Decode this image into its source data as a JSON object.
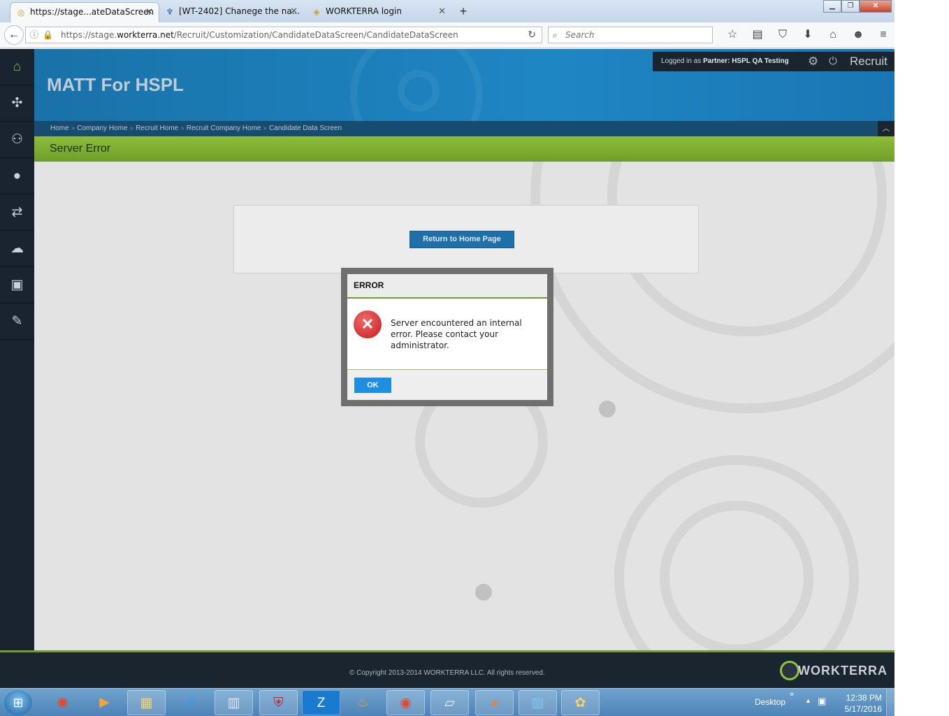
{
  "browser": {
    "tabs": [
      {
        "title": "https://stage...ateDataScreen",
        "favicon": "worktera-favicon-icon",
        "active": true
      },
      {
        "title": "[WT-2402] Chanege the na...",
        "favicon": "jira-icon",
        "active": false
      },
      {
        "title": "WORKTERRA login",
        "favicon": "worktera-favicon-icon",
        "active": false
      }
    ],
    "url_prefix": "https://stage.",
    "url_domain": "workterra.net",
    "url_path": "/Recruit/Customization/CandidateDataScreen/CandidateDataScreen",
    "search_placeholder": "Search"
  },
  "app": {
    "name": "MATT For HSPL",
    "logged_in_label": "Logged in as",
    "partner_label": "Partner:",
    "partner_name": "HSPL QA Testing",
    "module": "Recruit",
    "breadcrumb": [
      "Home",
      "Company Home",
      "Recruit Home",
      "Recruit Company Home",
      "Candidate Data Screen"
    ],
    "breadcrumb_separator": "»",
    "page_title": "Server Error",
    "return_home_button": "Return to Home Page",
    "footer_copyright": "© Copyright 2013-2014 WORKTERRA LLC. All rights reserved.",
    "footer_brand": "WORKTERRA",
    "colors": {
      "accent_green": "#6ea02a",
      "header_blue": "#1f86c4",
      "sidebar_dark": "#1a2430",
      "ok_blue": "#1e8fe0",
      "error_red": "#c41b1b"
    }
  },
  "sidebar": {
    "items": [
      {
        "icon": "home-icon"
      },
      {
        "icon": "puzzle-icon"
      },
      {
        "icon": "user-settings-icon"
      },
      {
        "icon": "user-icon"
      },
      {
        "icon": "transfer-icon"
      },
      {
        "icon": "chat-icon"
      },
      {
        "icon": "briefcase-icon"
      },
      {
        "icon": "clipboard-icon"
      }
    ]
  },
  "dialog": {
    "title": "ERROR",
    "message": "Server encountered an internal error. Please contact your administrator.",
    "ok_label": "OK"
  },
  "taskbar": {
    "desktop_label": "Desktop",
    "time": "12:38 PM",
    "date": "5/17/2016"
  }
}
